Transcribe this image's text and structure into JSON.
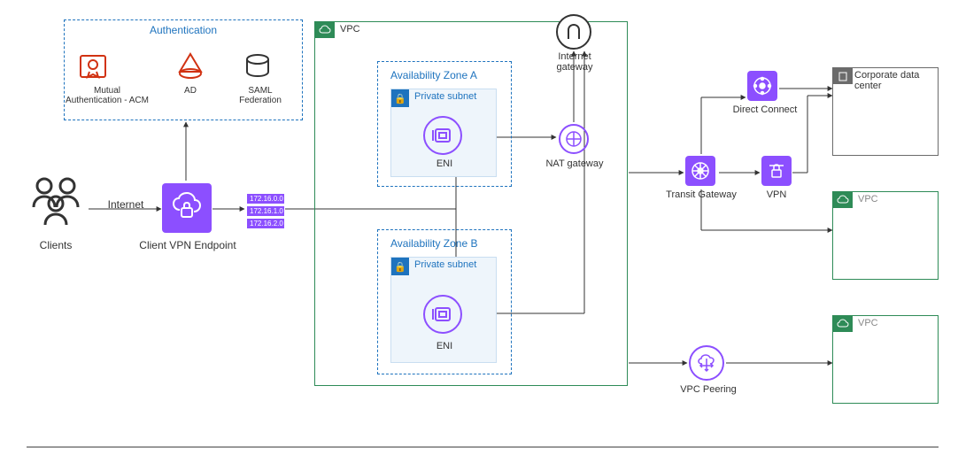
{
  "clients_label": "Clients",
  "internet_label": "Internet",
  "client_vpn_label": "Client VPN Endpoint",
  "auth": {
    "box_title": "Authentication",
    "acm_label": "Mutual\nAuthentication - ACM",
    "ad_label": "AD",
    "saml_label": "SAML\nFederation"
  },
  "cidrs": [
    "172.16.0.0",
    "172.16.1.0",
    "172.16.2.0"
  ],
  "vpc_main": {
    "badge": "VPC",
    "az_a_title": "Availability Zone A",
    "az_b_title": "Availability Zone B",
    "subnet_label": "Private subnet",
    "eni_label": "ENI",
    "nat_label": "NAT gateway",
    "igw_label": "Internet\ngateway"
  },
  "transit_gateway_label": "Transit Gateway",
  "direct_connect_label": "Direct Connect",
  "vpn_label": "VPN",
  "corporate_dc_label": "Corporate data\ncenter",
  "vpc_peering_label": "VPC Peering",
  "vpc_right_label": "VPC"
}
